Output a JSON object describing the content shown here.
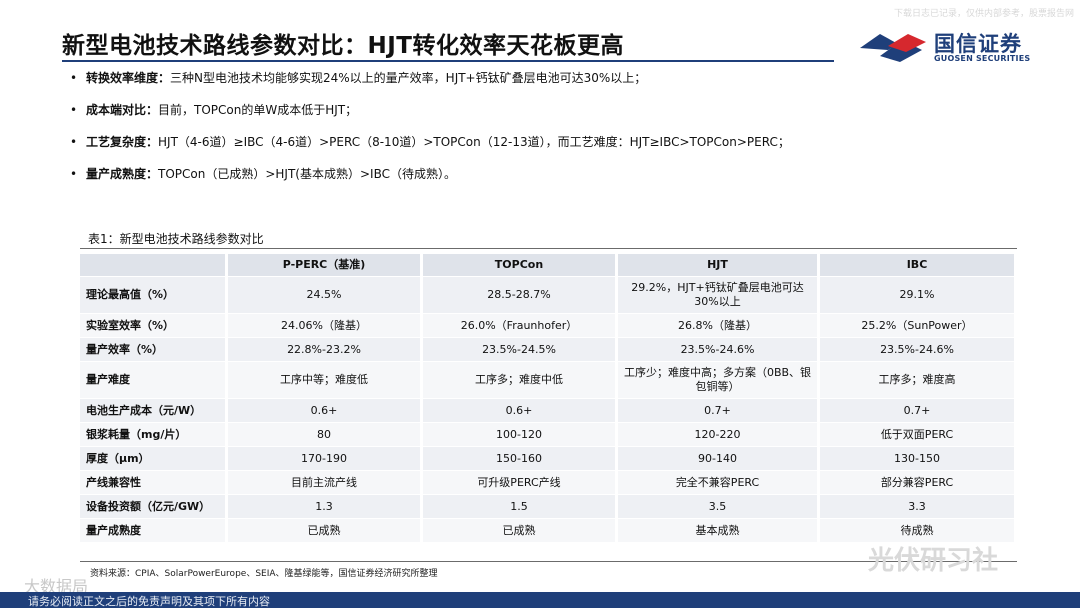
{
  "top_note": "下载日志已记录，仅供内部参考，股票报告网",
  "title": "新型电池技术路线参数对比：HJT转化效率天花板更高",
  "logo": {
    "name": "国信证券",
    "english": "GUOSEN SECURITIES",
    "colors": {
      "blue": "#1f3f7a",
      "red": "#d6282e"
    }
  },
  "bullets": [
    {
      "label": "转换效率维度：",
      "text": "三种N型电池技术均能够实现24%以上的量产效率，HJT+钙钛矿叠层电池可达30%以上；"
    },
    {
      "label": "成本端对比：",
      "text": "目前，TOPCon的单W成本低于HJT；"
    },
    {
      "label": "工艺复杂度：",
      "text": "HJT（4-6道）≥IBC（4-6道）>PERC（8-10道）>TOPCon（12-13道），而工艺难度：HJT≥IBC>TOPCon>PERC；"
    },
    {
      "label": "量产成熟度：",
      "text": "TOPCon（已成熟）>HJT(基本成熟）>IBC（待成熟）。"
    }
  ],
  "table": {
    "caption": "表1：新型电池技术路线参数对比",
    "headers": [
      "",
      "P-PERC（基准)",
      "TOPCon",
      "HJT",
      "IBC"
    ],
    "rows": [
      {
        "label": "理论最高值（%）",
        "cells": [
          "24.5%",
          "28.5-28.7%",
          "29.2%，HJT+钙钛矿叠层电池可达30%以上",
          "29.1%"
        ]
      },
      {
        "label": "实验室效率（%）",
        "cells": [
          "24.06%（隆基）",
          "26.0%（Fraunhofer）",
          "26.8%（隆基）",
          "25.2%（SunPower）"
        ]
      },
      {
        "label": "量产效率（%）",
        "cells": [
          "22.8%-23.2%",
          "23.5%-24.5%",
          "23.5%-24.6%",
          "23.5%-24.6%"
        ]
      },
      {
        "label": "量产难度",
        "cells": [
          "工序中等；难度低",
          "工序多；难度中低",
          "工序少；难度中高；多方案（0BB、银包铜等）",
          "工序多；难度高"
        ]
      },
      {
        "label": "电池生产成本（元/W）",
        "cells": [
          "0.6+",
          "0.6+",
          "0.7+",
          "0.7+"
        ]
      },
      {
        "label": "银浆耗量（mg/片）",
        "cells": [
          "80",
          "100-120",
          "120-220",
          "低于双面PERC"
        ]
      },
      {
        "label": "厚度（μm）",
        "cells": [
          "170-190",
          "150-160",
          "90-140",
          "130-150"
        ]
      },
      {
        "label": "产线兼容性",
        "cells": [
          "目前主流产线",
          "可升级PERC产线",
          "完全不兼容PERC",
          "部分兼容PERC"
        ]
      },
      {
        "label": "设备投资额（亿元/GW）",
        "cells": [
          "1.3",
          "1.5",
          "3.5",
          "3.3"
        ]
      },
      {
        "label": "量产成熟度",
        "cells": [
          "已成熟",
          "已成熟",
          "基本成熟",
          "待成熟"
        ]
      }
    ]
  },
  "source": "资料来源：CPIA、SolarPowerEurope、SEIA、隆基绿能等，国信证券经济研究所整理",
  "watermark": "光伏研习社",
  "watermark_left": "大数据局",
  "footer": "请务必阅读正文之后的免责声明及其项下所有内容"
}
